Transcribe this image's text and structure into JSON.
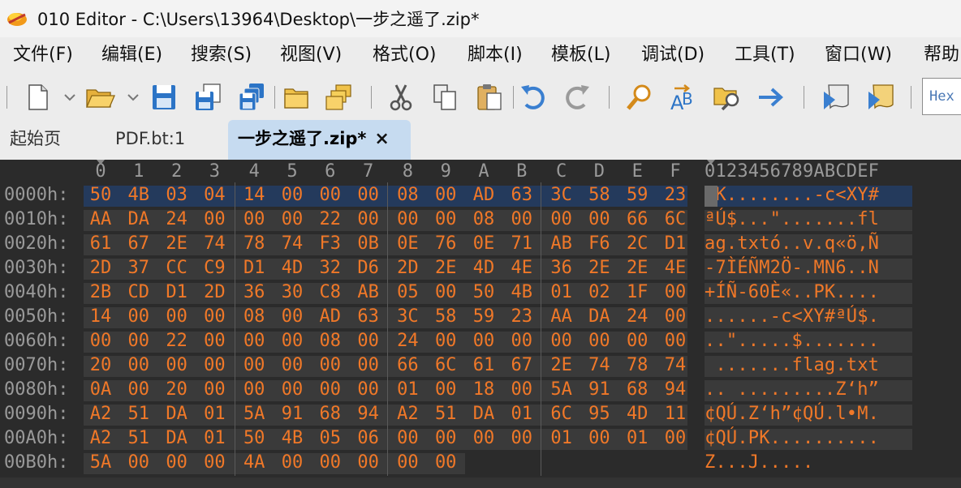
{
  "window": {
    "title": "010 Editor - C:\\Users\\13964\\Desktop\\一步之遥了.zip*"
  },
  "menu": [
    "文件(F)",
    "编辑(E)",
    "搜索(S)",
    "视图(V)",
    "格式(O)",
    "脚本(I)",
    "模板(L)",
    "调试(D)",
    "工具(T)",
    "窗口(W)",
    "帮助"
  ],
  "toolbar": {
    "hex_label": "Hex"
  },
  "tabs": [
    {
      "label": "起始页",
      "active": false
    },
    {
      "label": "PDF.bt:1",
      "active": false
    },
    {
      "label": "一步之遥了.zip*",
      "active": true,
      "close": "×"
    }
  ],
  "hex_view": {
    "column_headers": [
      "0",
      "1",
      "2",
      "3",
      "4",
      "5",
      "6",
      "7",
      "8",
      "9",
      "A",
      "B",
      "C",
      "D",
      "E",
      "F"
    ],
    "ascii_header": "0123456789ABCDEF",
    "rows": [
      {
        "offset": "0000h:",
        "bytes": [
          "50",
          "4B",
          "03",
          "04",
          "14",
          "00",
          "00",
          "00",
          "08",
          "00",
          "AD",
          "63",
          "3C",
          "58",
          "59",
          "23"
        ],
        "ascii": "PK........-c<XY#"
      },
      {
        "offset": "0010h:",
        "bytes": [
          "AA",
          "DA",
          "24",
          "00",
          "00",
          "00",
          "22",
          "00",
          "00",
          "00",
          "08",
          "00",
          "00",
          "00",
          "66",
          "6C"
        ],
        "ascii": "ªÚ$...\".......fl"
      },
      {
        "offset": "0020h:",
        "bytes": [
          "61",
          "67",
          "2E",
          "74",
          "78",
          "74",
          "F3",
          "0B",
          "0E",
          "76",
          "0E",
          "71",
          "AB",
          "F6",
          "2C",
          "D1"
        ],
        "ascii": "ag.txtó..v.q«ö,Ñ"
      },
      {
        "offset": "0030h:",
        "bytes": [
          "2D",
          "37",
          "CC",
          "C9",
          "D1",
          "4D",
          "32",
          "D6",
          "2D",
          "2E",
          "4D",
          "4E",
          "36",
          "2E",
          "2E",
          "4E"
        ],
        "ascii": "-7ÌÉÑM2Ö-.MN6..N"
      },
      {
        "offset": "0040h:",
        "bytes": [
          "2B",
          "CD",
          "D1",
          "2D",
          "36",
          "30",
          "C8",
          "AB",
          "05",
          "00",
          "50",
          "4B",
          "01",
          "02",
          "1F",
          "00"
        ],
        "ascii": "+ÍÑ-60È«..PK...."
      },
      {
        "offset": "0050h:",
        "bytes": [
          "14",
          "00",
          "00",
          "00",
          "08",
          "00",
          "AD",
          "63",
          "3C",
          "58",
          "59",
          "23",
          "AA",
          "DA",
          "24",
          "00"
        ],
        "ascii": "......-c<XY#ªÚ$."
      },
      {
        "offset": "0060h:",
        "bytes": [
          "00",
          "00",
          "22",
          "00",
          "00",
          "00",
          "08",
          "00",
          "24",
          "00",
          "00",
          "00",
          "00",
          "00",
          "00",
          "00"
        ],
        "ascii": "..\".....$......."
      },
      {
        "offset": "0070h:",
        "bytes": [
          "20",
          "00",
          "00",
          "00",
          "00",
          "00",
          "00",
          "00",
          "66",
          "6C",
          "61",
          "67",
          "2E",
          "74",
          "78",
          "74"
        ],
        "ascii": " .......flag.txt"
      },
      {
        "offset": "0080h:",
        "bytes": [
          "0A",
          "00",
          "20",
          "00",
          "00",
          "00",
          "00",
          "00",
          "01",
          "00",
          "18",
          "00",
          "5A",
          "91",
          "68",
          "94"
        ],
        "ascii": ".. .........Z‘h”"
      },
      {
        "offset": "0090h:",
        "bytes": [
          "A2",
          "51",
          "DA",
          "01",
          "5A",
          "91",
          "68",
          "94",
          "A2",
          "51",
          "DA",
          "01",
          "6C",
          "95",
          "4D",
          "11"
        ],
        "ascii": "¢QÚ.Z‘h”¢QÚ.l•M."
      },
      {
        "offset": "00A0h:",
        "bytes": [
          "A2",
          "51",
          "DA",
          "01",
          "50",
          "4B",
          "05",
          "06",
          "00",
          "00",
          "00",
          "00",
          "01",
          "00",
          "01",
          "00"
        ],
        "ascii": "¢QÚ.PK.........."
      },
      {
        "offset": "00B0h:",
        "bytes": [
          "5A",
          "00",
          "00",
          "00",
          "4A",
          "00",
          "00",
          "00",
          "00",
          "00"
        ],
        "ascii": "Z...J....."
      }
    ]
  },
  "colors": {
    "byte_text": "#f07828",
    "selection": "#243a5c",
    "background": "#2b2b2b",
    "active_tab": "#c6dbf0"
  },
  "icons": [
    "new-file-icon",
    "open-folder-icon",
    "save-icon",
    "save-as-icon",
    "save-all-icon",
    "folder-icon",
    "open-workspace-icon",
    "cut-icon",
    "copy-icon",
    "paste-icon",
    "undo-icon",
    "redo-icon",
    "find-icon",
    "replace-icon",
    "find-in-files-icon",
    "goto-icon",
    "run-script-icon",
    "run-template-icon"
  ]
}
